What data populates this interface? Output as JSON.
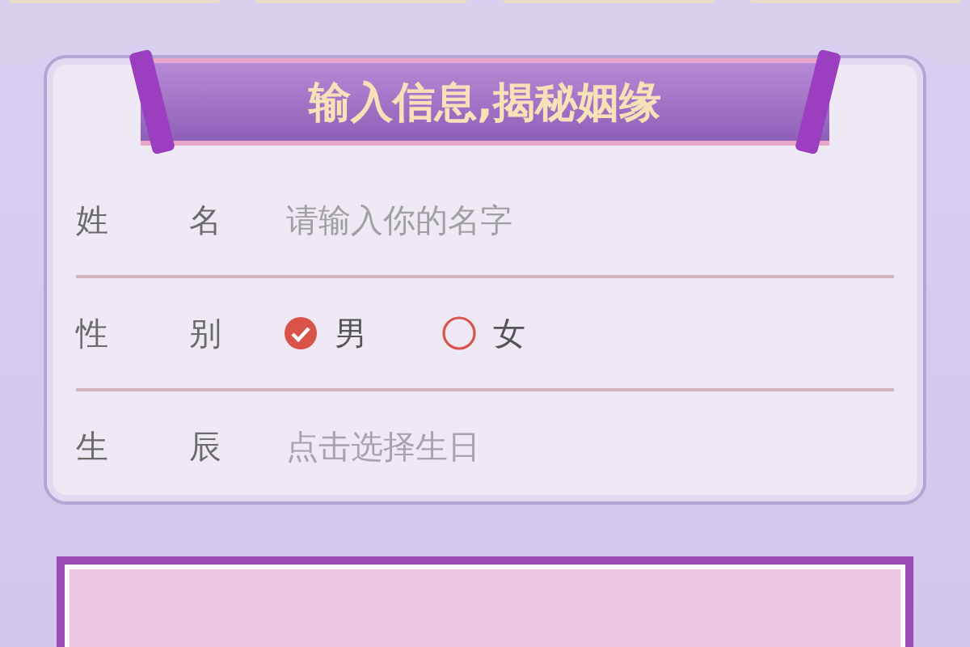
{
  "banner": {
    "title": "输入信息,揭秘姻缘"
  },
  "form": {
    "name": {
      "label": "姓名",
      "placeholder": "请输入你的名字"
    },
    "gender": {
      "label": "性别",
      "options": [
        {
          "label": "男",
          "selected": true
        },
        {
          "label": "女",
          "selected": false
        }
      ]
    },
    "birth": {
      "label": "生辰",
      "placeholder": "点击选择生日"
    }
  }
}
